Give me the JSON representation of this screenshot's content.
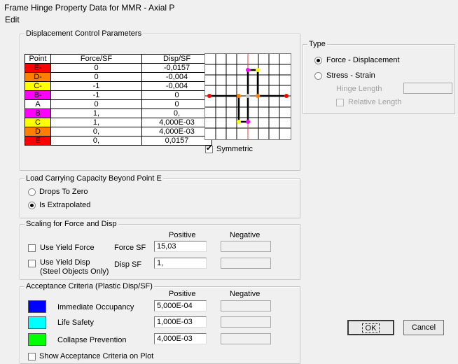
{
  "window": {
    "title": "Frame Hinge Property Data for MMR - Axial P",
    "menu_edit": "Edit"
  },
  "displacement": {
    "group_title": "Displacement Control Parameters",
    "headers": [
      "Point",
      "Force/SF",
      "Disp/SF"
    ],
    "rows": [
      {
        "point": "E-",
        "force": "0",
        "disp": "-0,0157",
        "color": "#ff0000"
      },
      {
        "point": "D-",
        "force": "0",
        "disp": "-0,004",
        "color": "#ff8000"
      },
      {
        "point": "C-",
        "force": "-1",
        "disp": "-0,004",
        "color": "#ffff00"
      },
      {
        "point": "B-",
        "force": "-1",
        "disp": "0",
        "color": "#ff00ff"
      },
      {
        "point": "A",
        "force": "0",
        "disp": "0",
        "color": "#ffffff"
      },
      {
        "point": "B",
        "force": "1,",
        "disp": "0,",
        "color": "#ff00ff"
      },
      {
        "point": "C",
        "force": "1,",
        "disp": "4,000E-03",
        "color": "#ffff00"
      },
      {
        "point": "D",
        "force": "0,",
        "disp": "4,000E-03",
        "color": "#ff8000"
      },
      {
        "point": "E",
        "force": "0,",
        "disp": "0,0157",
        "color": "#ff0000"
      }
    ],
    "symmetric_label": "Symmetric",
    "symmetric_checked": true
  },
  "load": {
    "group_title": "Load Carrying Capacity Beyond Point E",
    "opt_drops": "Drops To Zero",
    "opt_extrap": "Is Extrapolated",
    "selected": "Is Extrapolated"
  },
  "scaling": {
    "group_title": "Scaling for Force and Disp",
    "col_positive": "Positive",
    "col_negative": "Negative",
    "use_yield_force": "Use Yield Force",
    "use_yield_disp": "Use Yield Disp",
    "steel_note": "(Steel Objects Only)",
    "force_sf_label": "Force SF",
    "disp_sf_label": "Disp SF",
    "force_sf_value": "15,03",
    "disp_sf_value": "1,"
  },
  "acceptance": {
    "group_title": "Acceptance Criteria (Plastic Disp/SF)",
    "col_positive": "Positive",
    "col_negative": "Negative",
    "items": [
      {
        "label": "Immediate Occupancy",
        "value": "5,000E-04",
        "color": "#0000ff"
      },
      {
        "label": "Life Safety",
        "value": "1,000E-03",
        "color": "#00ffff"
      },
      {
        "label": "Collapse Prevention",
        "value": "4,000E-03",
        "color": "#00ff00"
      }
    ],
    "show_on_plot": "Show Acceptance Criteria on Plot"
  },
  "type": {
    "group_title": "Type",
    "opt_force": "Force - Displacement",
    "opt_stress": "Stress - Strain",
    "hinge_length": "Hinge Length",
    "relative_length": "Relative Length",
    "selected": "Force - Displacement"
  },
  "buttons": {
    "ok": "OK",
    "cancel": "Cancel"
  }
}
